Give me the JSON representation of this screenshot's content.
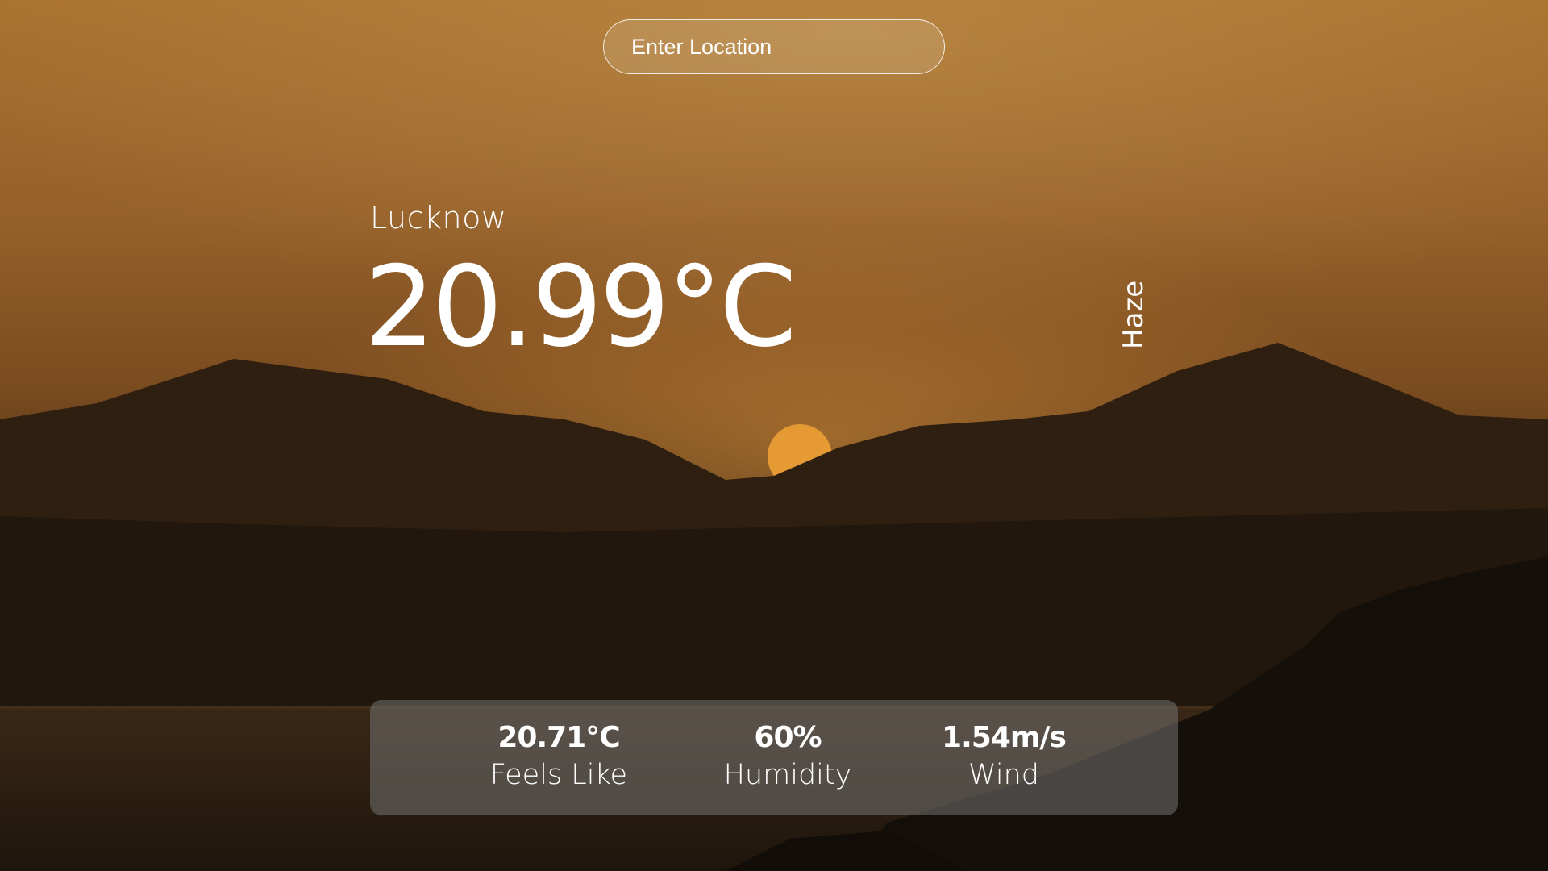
{
  "search": {
    "placeholder": "Enter Location",
    "value": ""
  },
  "weather": {
    "city": "Lucknow",
    "temperature": "20.99°C",
    "condition": "Haze"
  },
  "stats": {
    "feels_like": {
      "value": "20.71°C",
      "label": "Feels Like"
    },
    "humidity": {
      "value": "60%",
      "label": "Humidity"
    },
    "wind": {
      "value": "1.54m/s",
      "label": "Wind"
    }
  },
  "background": {
    "image": "sunset-mountains-sea-photo",
    "colors": {
      "sky_top": "#a56b2a",
      "sky_mid": "#8a5420",
      "mountain_far": "#3a2512",
      "mountain_near": "#241a10",
      "sea": "#2a1e12",
      "sun": "#e69a33"
    }
  },
  "panel_color": "#737373"
}
